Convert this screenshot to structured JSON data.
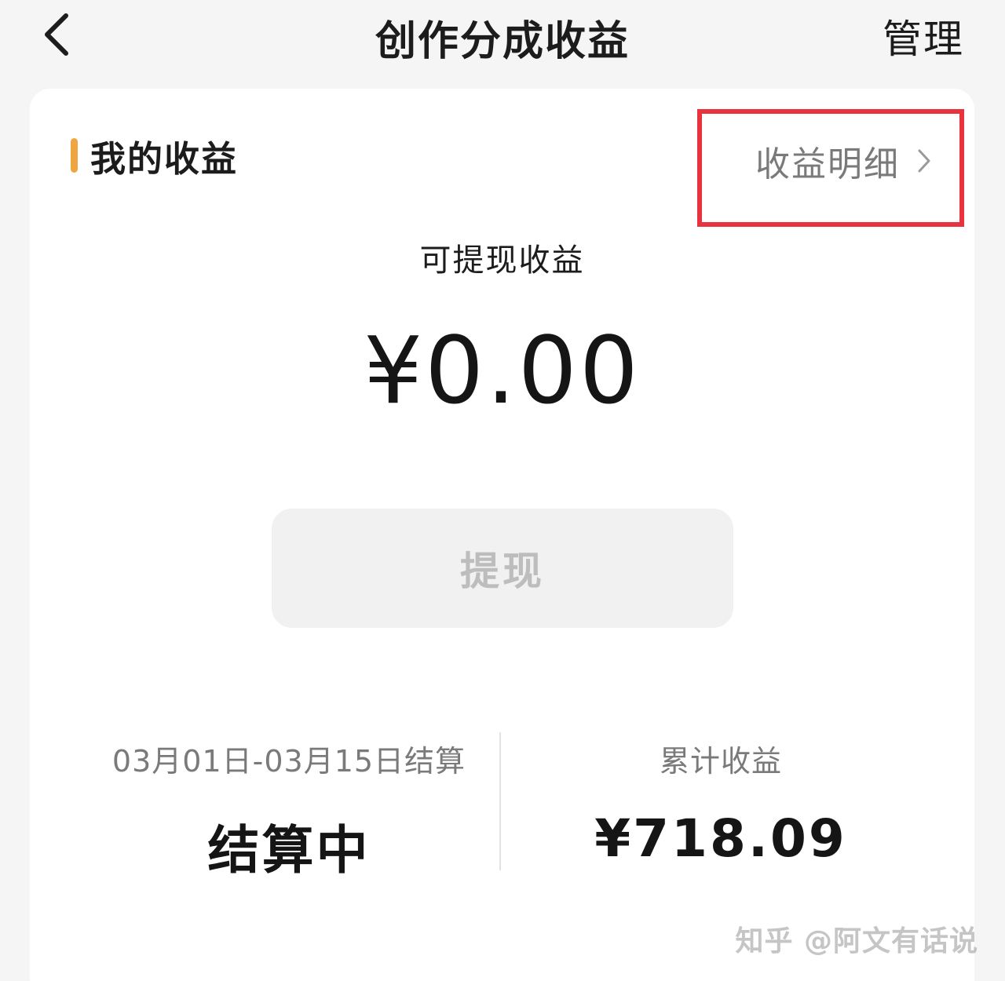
{
  "header": {
    "title": "创作分成收益",
    "manage_label": "管理",
    "back_icon": "chevron-left-icon"
  },
  "earnings": {
    "section_title": "我的收益",
    "accent_color": "#f0a640",
    "detail_link_label": "收益明细",
    "detail_highlight_color": "#e8323e",
    "withdrawable_label": "可提现收益",
    "withdrawable_amount": "¥0.00",
    "withdraw_button_label": "提现"
  },
  "stats": {
    "period_label": "03月01日-03月15日结算",
    "period_status": "结算中",
    "total_label": "累计收益",
    "total_amount": "¥718.09"
  },
  "watermark": "知乎 @阿文有话说"
}
